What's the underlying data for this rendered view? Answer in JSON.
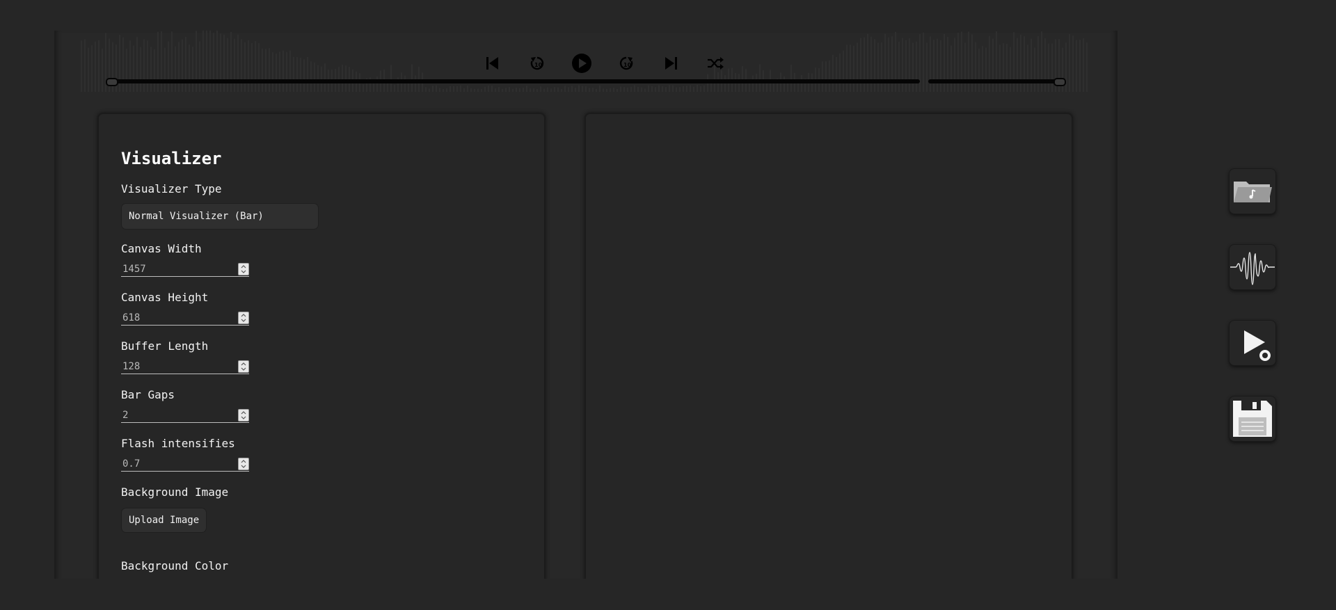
{
  "player": {
    "controls": [
      {
        "name": "skip-previous-icon",
        "label": "previous"
      },
      {
        "name": "rewind-10-icon",
        "label": "rewind 10"
      },
      {
        "name": "play-icon",
        "label": "play"
      },
      {
        "name": "forward-10-icon",
        "label": "forward 10"
      },
      {
        "name": "skip-next-icon",
        "label": "next"
      },
      {
        "name": "shuffle-icon",
        "label": "shuffle"
      }
    ],
    "rewind_badge": "10",
    "forward_badge": "10",
    "seek_progress": 0.0,
    "volume_level": 1.0
  },
  "visualizer": {
    "title": "Visualizer",
    "type_label": "Visualizer Type",
    "type_value": "Normal Visualizer (Bar)",
    "fields": [
      {
        "label": "Canvas Width",
        "value": "1457"
      },
      {
        "label": "Canvas Height",
        "value": "618"
      },
      {
        "label": "Buffer Length",
        "value": "128"
      },
      {
        "label": "Bar Gaps",
        "value": "2"
      },
      {
        "label": "Flash intensifies",
        "value": "0.7"
      }
    ],
    "background_image_label": "Background Image",
    "upload_label": "Upload Image",
    "background_color_label": "Background Color"
  },
  "sidebar_tools": [
    {
      "name": "music-folder-icon"
    },
    {
      "name": "waveform-icon"
    },
    {
      "name": "play-settings-icon"
    },
    {
      "name": "floppy-save-icon"
    }
  ],
  "colors": {
    "background": "#262626",
    "panel": "#262626",
    "track": "#050505",
    "text": "#f0f0f0"
  }
}
